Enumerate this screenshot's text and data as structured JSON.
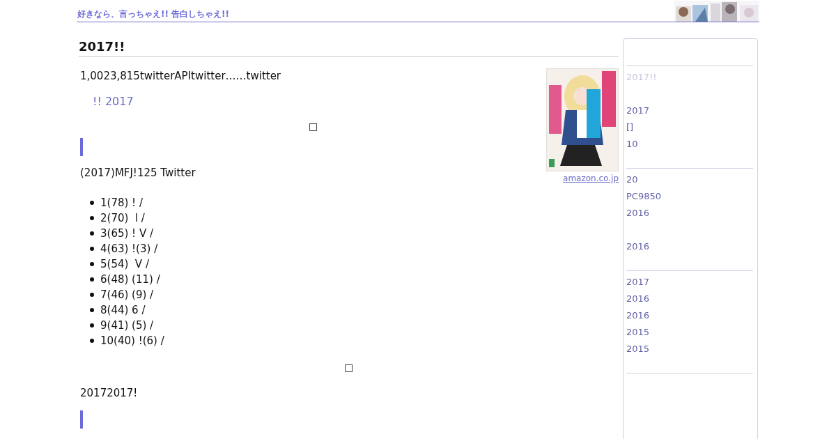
{
  "header": {
    "title": "好きなら、言っちゃえ!! 告白しちゃえ!!"
  },
  "article": {
    "title": "2017!!",
    "cover": {
      "kind": "picture",
      "source_link": "amazon.co.jp"
    },
    "intro": "1,0023,815twitterAPItwitter……twitter",
    "link": "!! 2017",
    "glyph_1": "□",
    "ranking_intro": "(2017)MFJ!125 Twitter",
    "ranking": [
      "1(78) ! /",
      "2(70)  l /",
      "3(65) ! V /",
      "4(63) !(3) /",
      "5(54)  V /",
      "6(48) (11) /",
      "7(46) (9) /",
      "8(44) 6 /",
      "9(41) (5) /",
      "10(40) !(6) /"
    ],
    "glyph_2": "□",
    "closing": "20172017!"
  },
  "sidebar": {
    "sections": [
      {
        "groups": [
          [
            {
              "label": "2017!!",
              "selected": true
            }
          ],
          [
            {
              "label": "2017",
              "selected": false
            },
            {
              "label": "[]",
              "selected": false
            },
            {
              "label": "10",
              "selected": false
            }
          ]
        ]
      },
      {
        "groups": [
          [
            {
              "label": "20",
              "selected": false
            },
            {
              "label": "PC9850",
              "selected": false
            },
            {
              "label": "2016",
              "selected": false
            }
          ],
          [
            {
              "label": "2016",
              "selected": false
            }
          ]
        ]
      },
      {
        "groups": [
          [
            {
              "label": "2017",
              "selected": false
            },
            {
              "label": "2016",
              "selected": false
            },
            {
              "label": "2016",
              "selected": false
            },
            {
              "label": "2015",
              "selected": false
            },
            {
              "label": "2015",
              "selected": false
            }
          ]
        ]
      }
    ]
  }
}
